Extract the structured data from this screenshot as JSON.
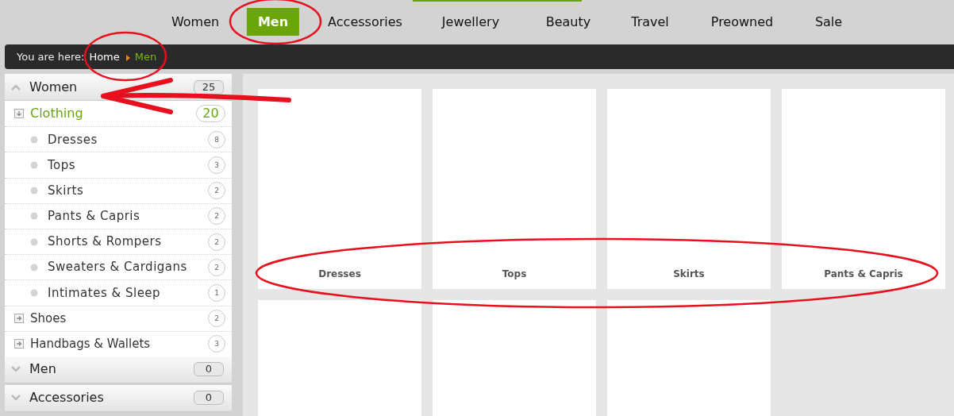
{
  "top_nav": [
    {
      "label": "Women",
      "selected": false
    },
    {
      "label": "Men",
      "selected": true
    },
    {
      "label": "Accessories",
      "selected": false
    },
    {
      "label": "Jewellery",
      "selected": false
    },
    {
      "label": "Beauty",
      "selected": false
    },
    {
      "label": "Travel",
      "selected": false
    },
    {
      "label": "Preowned",
      "selected": false
    },
    {
      "label": "Sale",
      "selected": false
    }
  ],
  "breadcrumb": {
    "prefix": "You are here:",
    "items": [
      {
        "label": "Home",
        "current": false
      },
      {
        "label": "Men",
        "current": true
      }
    ]
  },
  "sidebar": {
    "sections": [
      {
        "label": "Women",
        "count": "25",
        "expanded": true,
        "children": [
          {
            "label": "Clothing",
            "count": "20",
            "expanded": true,
            "children": [
              {
                "label": "Dresses",
                "count": "8"
              },
              {
                "label": "Tops",
                "count": "3"
              },
              {
                "label": "Skirts",
                "count": "2"
              },
              {
                "label": "Pants & Capris",
                "count": "2"
              },
              {
                "label": "Shorts & Rompers",
                "count": "2"
              },
              {
                "label": "Sweaters & Cardigans",
                "count": "2"
              },
              {
                "label": "Intimates & Sleep",
                "count": "1"
              }
            ]
          },
          {
            "label": "Shoes",
            "count": "2",
            "expanded": false
          },
          {
            "label": "Handbags & Wallets",
            "count": "3",
            "expanded": false
          }
        ]
      },
      {
        "label": "Men",
        "count": "0",
        "expanded": false
      },
      {
        "label": "Accessories",
        "count": "0",
        "expanded": false
      }
    ]
  },
  "tiles": [
    {
      "kind": "labeled",
      "label": "Dresses"
    },
    {
      "kind": "labeled",
      "label": "Tops"
    },
    {
      "kind": "labeled",
      "label": "Skirts"
    },
    {
      "kind": "labeled",
      "label": "Pants & Capris"
    },
    {
      "kind": "blank"
    },
    {
      "kind": "blank"
    },
    {
      "kind": "blank"
    }
  ]
}
